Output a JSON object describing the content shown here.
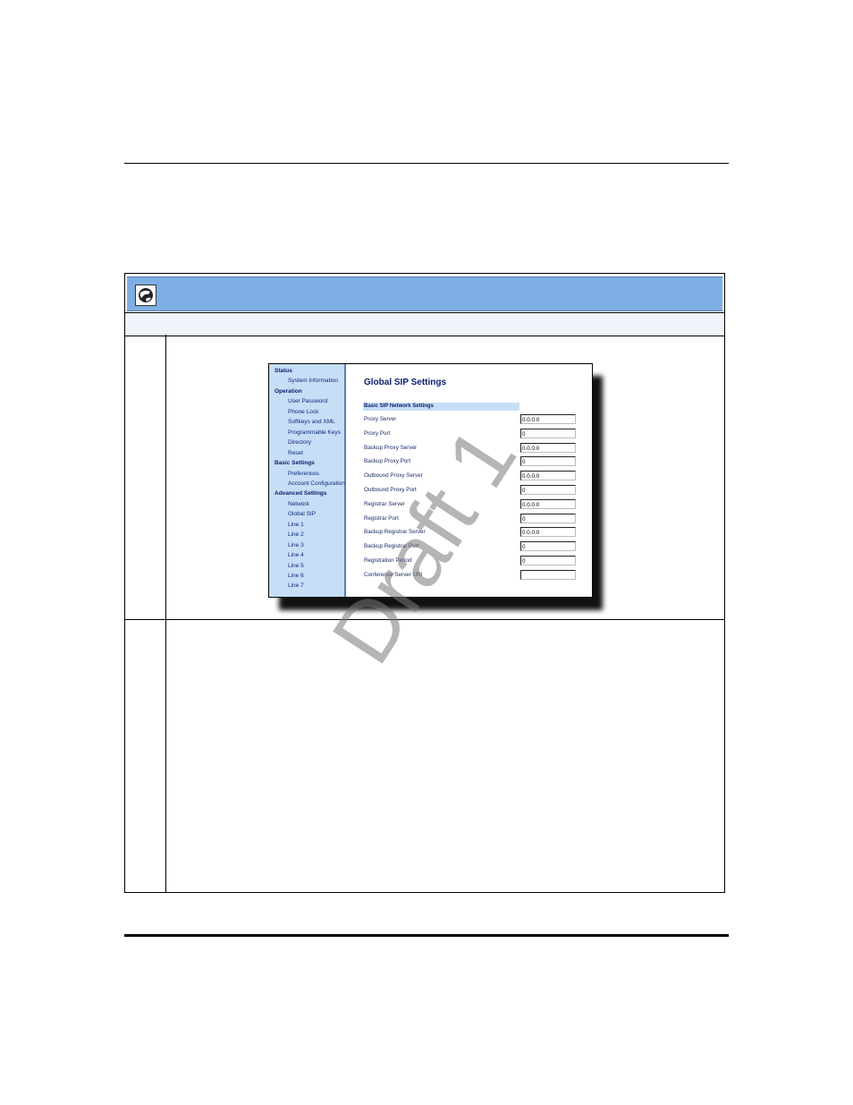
{
  "watermark": "Draft 1",
  "screenshot": {
    "nav": [
      {
        "type": "section",
        "label": "Status"
      },
      {
        "type": "item",
        "label": "System Information"
      },
      {
        "type": "section",
        "label": "Operation"
      },
      {
        "type": "item",
        "label": "User Password"
      },
      {
        "type": "item",
        "label": "Phone Lock"
      },
      {
        "type": "item",
        "label": "Softkeys and XML"
      },
      {
        "type": "item",
        "label": "Programmable Keys"
      },
      {
        "type": "item",
        "label": "Directory"
      },
      {
        "type": "item",
        "label": "Reset"
      },
      {
        "type": "section",
        "label": "Basic Settings"
      },
      {
        "type": "item",
        "label": "Preferences"
      },
      {
        "type": "item",
        "label": "Account Configuration"
      },
      {
        "type": "section",
        "label": "Advanced Settings"
      },
      {
        "type": "item",
        "label": "Network"
      },
      {
        "type": "item",
        "label": "Global SIP"
      },
      {
        "type": "item",
        "label": "Line 1"
      },
      {
        "type": "item",
        "label": "Line 2"
      },
      {
        "type": "item",
        "label": "Line 3"
      },
      {
        "type": "item",
        "label": "Line 4"
      },
      {
        "type": "item",
        "label": "Line 5"
      },
      {
        "type": "item",
        "label": "Line 6"
      },
      {
        "type": "item",
        "label": "Line 7"
      }
    ],
    "title": "Global SIP Settings",
    "section_title": "Basic SIP Network Settings",
    "fields": [
      {
        "label": "Proxy Server",
        "value": "0.0.0.0"
      },
      {
        "label": "Proxy Port",
        "value": "0"
      },
      {
        "label": "Backup Proxy Server",
        "value": "0.0.0.0"
      },
      {
        "label": "Backup Proxy Port",
        "value": "0"
      },
      {
        "label": "Outbound Proxy Server",
        "value": "0.0.0.0"
      },
      {
        "label": "Outbound Proxy Port",
        "value": "0"
      },
      {
        "label": "Registrar Server",
        "value": "0.0.0.0"
      },
      {
        "label": "Registrar Port",
        "value": "0"
      },
      {
        "label": "Backup Registrar Server",
        "value": "0.0.0.0"
      },
      {
        "label": "Backup Registrar Port",
        "value": "0"
      },
      {
        "label": "Registration Period",
        "value": "0"
      },
      {
        "label": "Conference Server URI",
        "value": ""
      }
    ]
  }
}
